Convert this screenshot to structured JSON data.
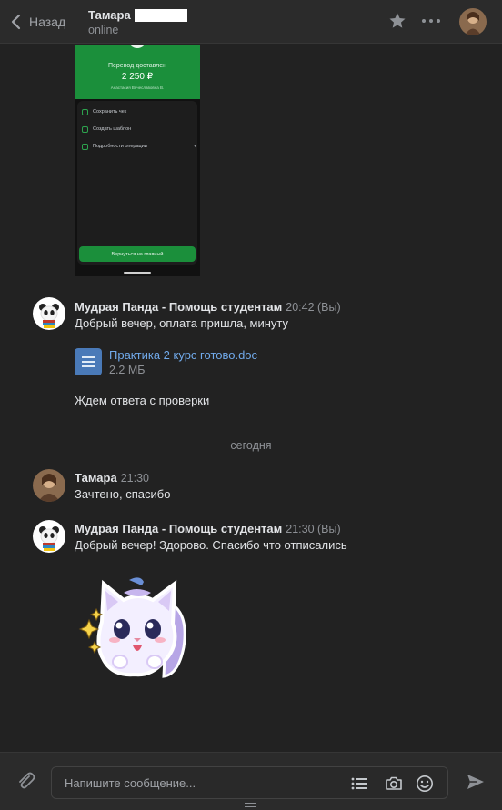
{
  "header": {
    "back_label": "Назад",
    "contact_name": "Тамара",
    "status": "online"
  },
  "receipt": {
    "title": "Перевод доставлен",
    "amount": "2 250 ₽",
    "recipient": "Анастасия Вячеславовна В.",
    "rows": [
      "Сохранить чек",
      "Создать шаблон",
      "Подробности операции"
    ],
    "button": "Вернуться на главный"
  },
  "messages": [
    {
      "author": "Мудрая Панда - Помощь студентам",
      "time": "20:42 (Вы)",
      "text": "Добрый вечер, оплата пришла, минуту",
      "attachment": {
        "name": "Практика 2 курс готово.doc",
        "size": "2.2 МБ"
      },
      "text2": "Ждем ответа с проверки"
    },
    {
      "author": "Тамара",
      "time": "21:30",
      "text": "Зачтено, спасибо"
    },
    {
      "author": "Мудрая Панда - Помощь студентам",
      "time": "21:30 (Вы)",
      "text": "Добрый вечер! Здорово. Спасибо что отписались"
    }
  ],
  "date_separator": "сегодня",
  "composer": {
    "placeholder": "Напишите сообщение..."
  },
  "icons": {
    "back": "chevron-left-icon",
    "star": "star-icon",
    "more": "more-icon",
    "attach": "paperclip-icon",
    "templates": "list-icon",
    "camera": "camera-icon",
    "emoji": "smile-icon",
    "send": "send-icon"
  },
  "colors": {
    "background": "#222222",
    "header": "#2b2b2b",
    "link": "#71aaeb",
    "muted": "#8e9196",
    "receipt_green": "#1b8f3b"
  }
}
